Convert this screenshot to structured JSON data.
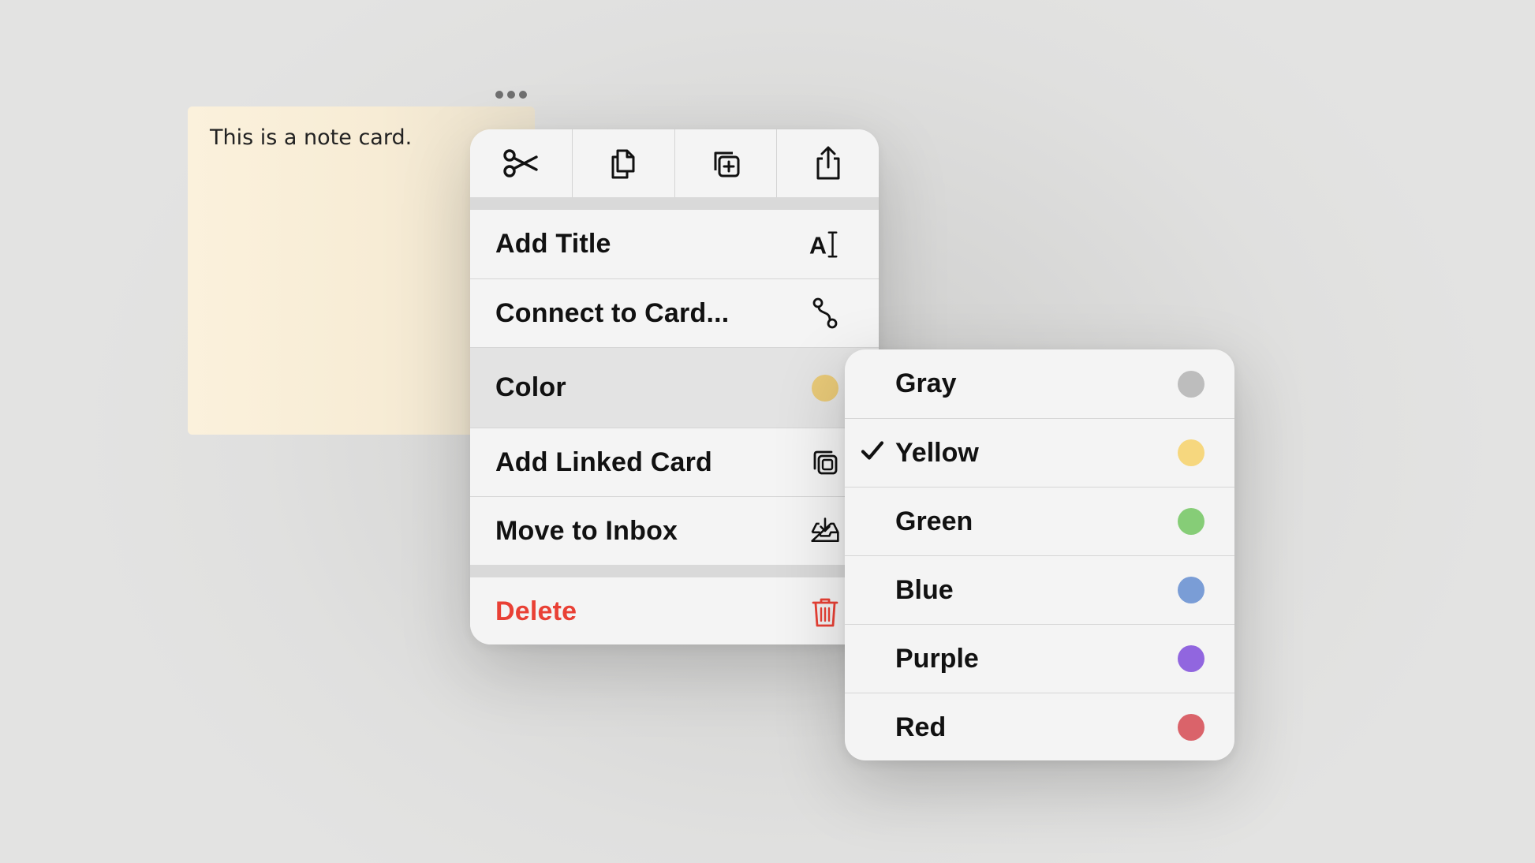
{
  "note": {
    "text": "This is a note card."
  },
  "toolbar": {
    "icons": [
      "scissors-icon",
      "copy-icon",
      "duplicate-icon",
      "share-icon"
    ]
  },
  "menu": {
    "add_title": "Add Title",
    "connect_to_card": "Connect to Card...",
    "color": "Color",
    "add_linked_card": "Add Linked Card",
    "move_to_inbox": "Move to Inbox",
    "delete": "Delete",
    "current_color": "#e8c978",
    "delete_color": "#e94035"
  },
  "color_submenu": {
    "selected": "Yellow",
    "items": [
      {
        "label": "Gray",
        "color": "#bdbdbd"
      },
      {
        "label": "Yellow",
        "color": "#f6d77e"
      },
      {
        "label": "Green",
        "color": "#86cd77"
      },
      {
        "label": "Blue",
        "color": "#7a9dd6"
      },
      {
        "label": "Purple",
        "color": "#9166df"
      },
      {
        "label": "Red",
        "color": "#da636a"
      }
    ]
  }
}
